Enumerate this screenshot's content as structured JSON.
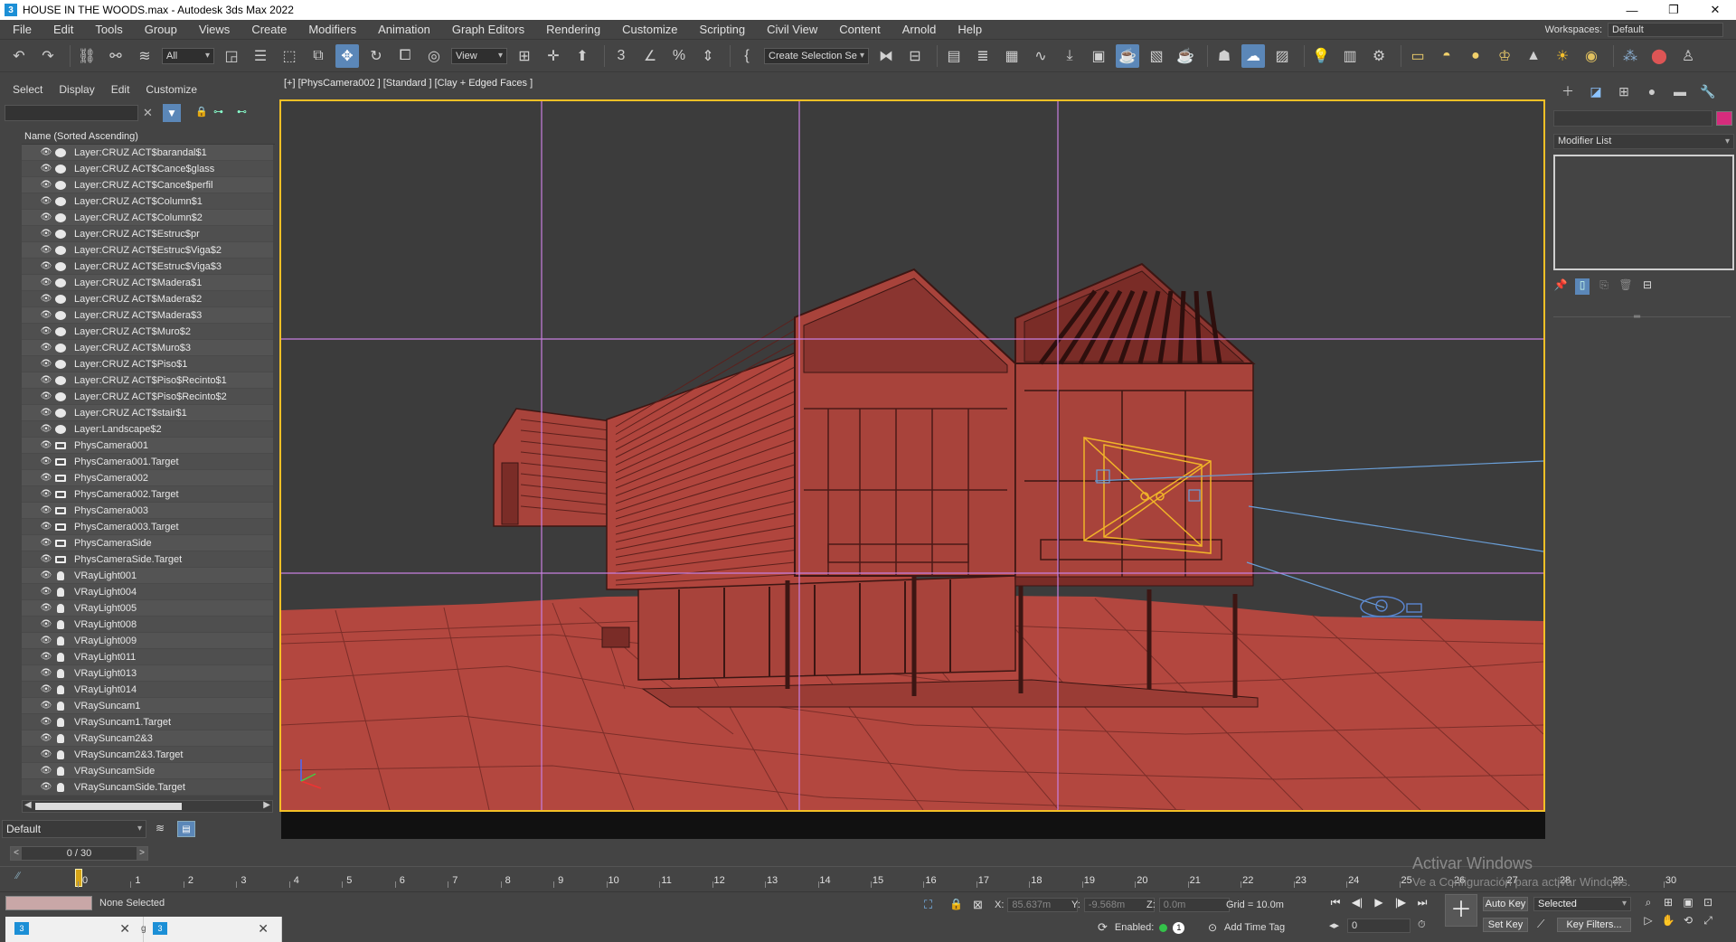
{
  "window": {
    "title": "HOUSE IN THE WOODS.max - Autodesk 3ds Max 2022",
    "app_icon": "3",
    "controls": [
      "—",
      "❐",
      "✕"
    ]
  },
  "menu": {
    "items": [
      "File",
      "Edit",
      "Tools",
      "Group",
      "Views",
      "Create",
      "Modifiers",
      "Animation",
      "Graph Editors",
      "Rendering",
      "Customize",
      "Scripting",
      "Civil View",
      "Content",
      "Arnold",
      "Help"
    ],
    "workspaces_label": "Workspaces:",
    "workspaces_value": "Default"
  },
  "toolbar": {
    "filter_value": "All",
    "view_value": "View",
    "selection_set_value": "Create Selection Se"
  },
  "scene_explorer": {
    "tabs": [
      "Select",
      "Display",
      "Edit",
      "Customize"
    ],
    "column_header": "Name (Sorted Ascending)",
    "rows": [
      {
        "name": "Layer:CRUZ ACT$barandal$1",
        "type": "layer"
      },
      {
        "name": "Layer:CRUZ ACT$Cance$glass",
        "type": "layer"
      },
      {
        "name": "Layer:CRUZ ACT$Cance$perfil",
        "type": "layer"
      },
      {
        "name": "Layer:CRUZ ACT$Column$1",
        "type": "layer"
      },
      {
        "name": "Layer:CRUZ ACT$Column$2",
        "type": "layer"
      },
      {
        "name": "Layer:CRUZ ACT$Estruc$pr",
        "type": "layer"
      },
      {
        "name": "Layer:CRUZ ACT$Estruc$Viga$2",
        "type": "layer"
      },
      {
        "name": "Layer:CRUZ ACT$Estruc$Viga$3",
        "type": "layer"
      },
      {
        "name": "Layer:CRUZ ACT$Madera$1",
        "type": "layer"
      },
      {
        "name": "Layer:CRUZ ACT$Madera$2",
        "type": "layer"
      },
      {
        "name": "Layer:CRUZ ACT$Madera$3",
        "type": "layer"
      },
      {
        "name": "Layer:CRUZ ACT$Muro$2",
        "type": "layer"
      },
      {
        "name": "Layer:CRUZ ACT$Muro$3",
        "type": "layer"
      },
      {
        "name": "Layer:CRUZ ACT$Piso$1",
        "type": "layer"
      },
      {
        "name": "Layer:CRUZ ACT$Piso$Recinto$1",
        "type": "layer"
      },
      {
        "name": "Layer:CRUZ ACT$Piso$Recinto$2",
        "type": "layer"
      },
      {
        "name": "Layer:CRUZ ACT$stair$1",
        "type": "layer"
      },
      {
        "name": "Layer:Landscape$2",
        "type": "layer"
      },
      {
        "name": "PhysCamera001",
        "type": "camera"
      },
      {
        "name": "PhysCamera001.Target",
        "type": "camera"
      },
      {
        "name": "PhysCamera002",
        "type": "camera"
      },
      {
        "name": "PhysCamera002.Target",
        "type": "camera"
      },
      {
        "name": "PhysCamera003",
        "type": "camera"
      },
      {
        "name": "PhysCamera003.Target",
        "type": "camera"
      },
      {
        "name": "PhysCameraSide",
        "type": "camera"
      },
      {
        "name": "PhysCameraSide.Target",
        "type": "camera"
      },
      {
        "name": "VRayLight001",
        "type": "light"
      },
      {
        "name": "VRayLight004",
        "type": "light"
      },
      {
        "name": "VRayLight005",
        "type": "light"
      },
      {
        "name": "VRayLight008",
        "type": "light"
      },
      {
        "name": "VRayLight009",
        "type": "light"
      },
      {
        "name": "VRayLight011",
        "type": "light"
      },
      {
        "name": "VRayLight013",
        "type": "light"
      },
      {
        "name": "VRayLight014",
        "type": "light"
      },
      {
        "name": "VRaySuncam1",
        "type": "light"
      },
      {
        "name": "VRaySuncam1.Target",
        "type": "light"
      },
      {
        "name": "VRaySuncam2&3",
        "type": "light"
      },
      {
        "name": "VRaySuncam2&3.Target",
        "type": "light"
      },
      {
        "name": "VRaySuncamSide",
        "type": "light"
      },
      {
        "name": "VRaySuncamSide.Target",
        "type": "light"
      }
    ],
    "layer_value": "Default"
  },
  "viewport": {
    "label": "[+] [PhysCamera002 ] [Standard ] [Clay + Edged Faces ]",
    "border_color": "#f3c026",
    "model_color": "#b3473f"
  },
  "command_panel": {
    "modifier_list": "Modifier List",
    "object_color": "#d62c7d"
  },
  "time": {
    "frame_display": "0 / 30",
    "ticks": [
      "0",
      "1",
      "2",
      "3",
      "4",
      "5",
      "6",
      "7",
      "8",
      "9",
      "10",
      "11",
      "12",
      "13",
      "14",
      "15",
      "16",
      "17",
      "18",
      "19",
      "20",
      "21",
      "22",
      "23",
      "24",
      "25",
      "26",
      "27",
      "28",
      "29",
      "30"
    ],
    "current_frame": "0"
  },
  "status": {
    "selection": "None Selected",
    "x_label": "X:",
    "x_value": "85.637m",
    "y_label": "Y:",
    "y_value": "-9.568m",
    "z_label": "Z:",
    "z_value": "0.0m",
    "grid": "Grid = 10.0m",
    "enabled_label": "Enabled:",
    "enabled_count": "1",
    "add_time_tag": "Add Time Tag",
    "tab_label_fragment": "g"
  },
  "animation": {
    "auto_key": "Auto Key",
    "set_key": "Set Key",
    "key_mode_value": "Selected",
    "key_filters": "Key Filters...",
    "frame_value": "0"
  },
  "watermark": {
    "line1": "Activar Windows",
    "line2": "Ve a Configuración para activar Windows."
  }
}
